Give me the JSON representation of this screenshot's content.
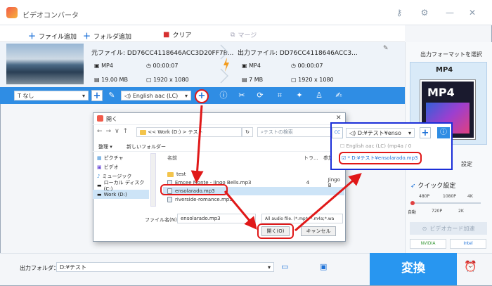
{
  "app": {
    "title": "ビデオコンバータ"
  },
  "toolbar": {
    "add_file": "ファイル追加",
    "add_folder": "フォルダ追加",
    "clear": "クリア",
    "merge": "マージ"
  },
  "file": {
    "source_label": "元ファイル: DD76CC4118646ACC3D20FF7B...",
    "output_label": "出力ファイル: DD76CC4118646ACC3...",
    "src_format": "MP4",
    "src_duration": "00:00:07",
    "src_size": "19.00 MB",
    "src_resolution": "1920 x 1080",
    "out_format": "MP4",
    "out_duration": "00:00:07",
    "out_size": "7 MB",
    "out_resolution": "1920 x 1080"
  },
  "tray": {
    "subtitle": "なし",
    "audio": "English aac (LC)"
  },
  "right_panel": {
    "select_format": "出力フォーマットを選択",
    "format": "MP4",
    "format_badge": "MP4",
    "settings": "設定",
    "quick_settings": "クイック設定",
    "ticks_top": [
      "480P",
      "1080P",
      "4K"
    ],
    "ticks_bottom": [
      "自動",
      "720P",
      "2K"
    ],
    "gpu_label": "ビデオカード加速",
    "gpu_nvidia": "NVIDIA",
    "gpu_intel": "Intel"
  },
  "bottom": {
    "output_folder_label": "出力フォルダ：",
    "output_folder_value": "D:¥テスト",
    "convert": "変換"
  },
  "dialog": {
    "title": "開く",
    "path": "<< Work (D:) > テスト",
    "search_placeholder": "テストの検索",
    "organize": "整理",
    "new_folder": "新しいフォルダー",
    "nav": [
      "ピクチャ",
      "ビデオ",
      "ミュージック",
      "ローカル ディスク (C:)",
      "Work (D:)"
    ],
    "col_name": "名前",
    "col_track": "トラ...",
    "col_artist": "参加...",
    "files": [
      {
        "name": "test",
        "type": "folder",
        "track": "",
        "artist": ""
      },
      {
        "name": "Emcee Monte - Jingo Bells.mp3",
        "type": "file",
        "track": "4",
        "artist": "Jingo B"
      },
      {
        "name": "ensolarado.mp3",
        "type": "file",
        "track": "",
        "artist": ""
      },
      {
        "name": "riverside-romance.mp3",
        "type": "file",
        "track": "",
        "artist": ""
      }
    ],
    "filename_label": "ファイル名(N):",
    "filename_value": "ensolarado.mp3",
    "filter": "All audio file. (*.mp*, *.m4a;*.wa",
    "open": "開く(O)",
    "cancel": "キャンセル"
  },
  "callout": {
    "audio_dropdown": "D:¥テスト¥enso",
    "option1": "English aac (LC) (mp4a / 0",
    "option2": "* D:¥テスト¥ensolarado.mp3"
  }
}
